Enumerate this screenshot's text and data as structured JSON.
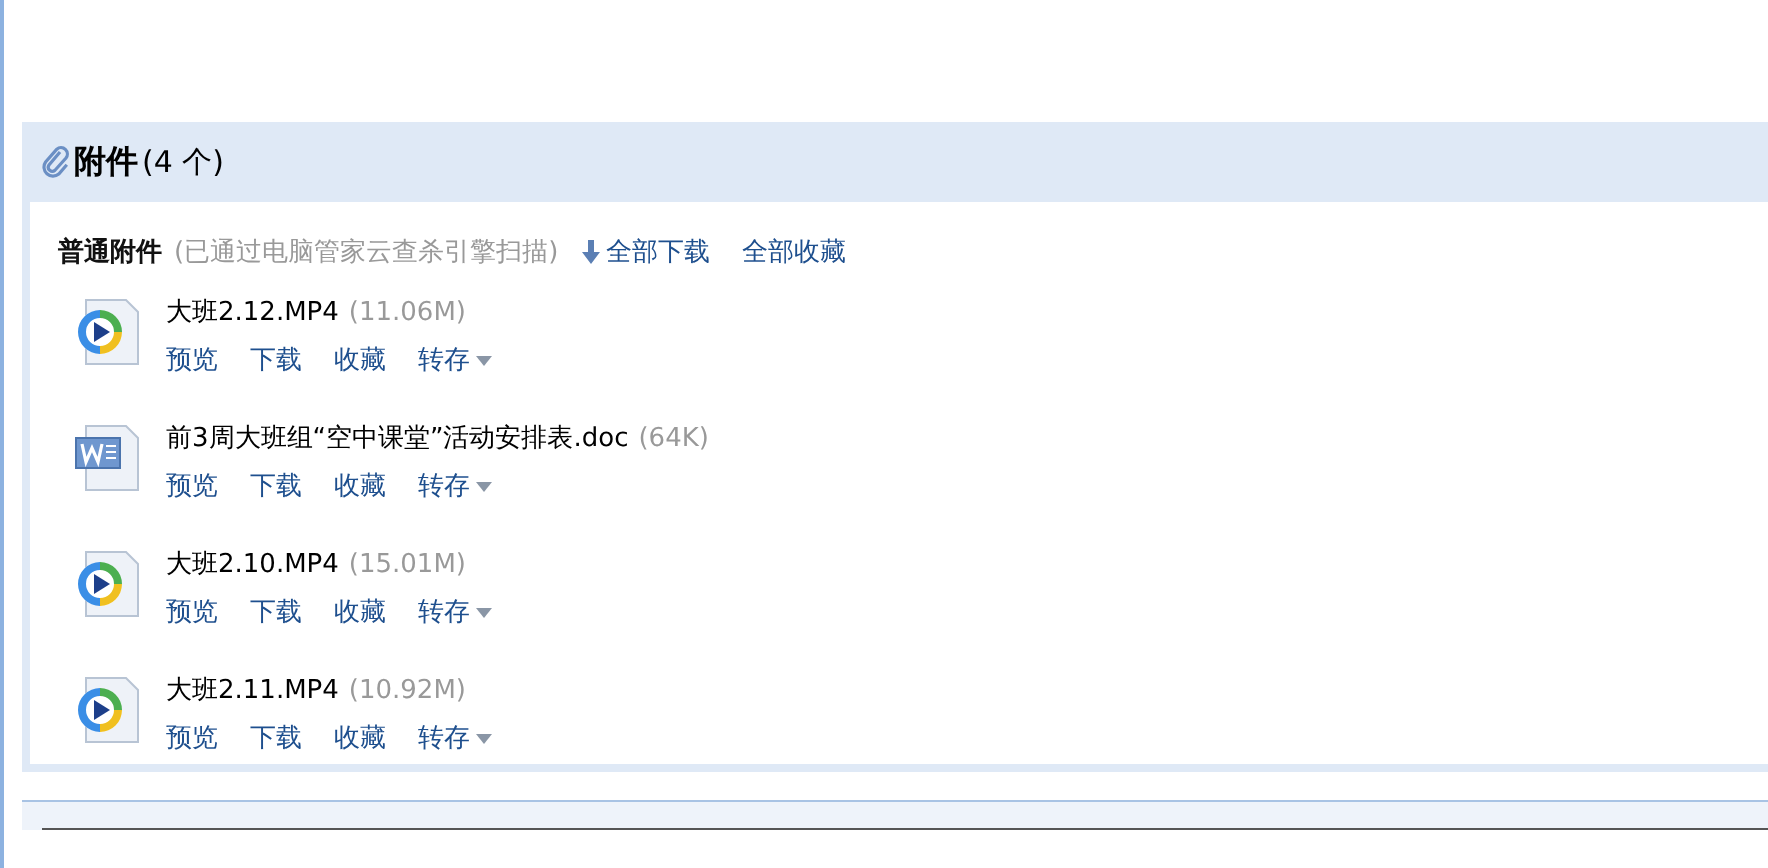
{
  "attachments": {
    "title": "附件",
    "count": "(4 个)",
    "section_label": "普通附件",
    "scan_note": "(已通过电脑管家云查杀引擎扫描)",
    "download_all": "全部下载",
    "favorite_all": "全部收藏",
    "files": [
      {
        "kind": "video",
        "name": "大班2.12.MP4",
        "size": "(11.06M)",
        "actions": [
          "预览",
          "下载",
          "收藏",
          "转存"
        ]
      },
      {
        "kind": "doc",
        "name": "前3周大班组“空中课堂”活动安排表.doc",
        "size": "(64K)",
        "actions": [
          "预览",
          "下载",
          "收藏",
          "转存"
        ]
      },
      {
        "kind": "video",
        "name": "大班2.10.MP4",
        "size": "(15.01M)",
        "actions": [
          "预览",
          "下载",
          "收藏",
          "转存"
        ]
      },
      {
        "kind": "video",
        "name": "大班2.11.MP4",
        "size": "(10.92M)",
        "actions": [
          "预览",
          "下载",
          "收藏",
          "转存"
        ]
      }
    ]
  }
}
